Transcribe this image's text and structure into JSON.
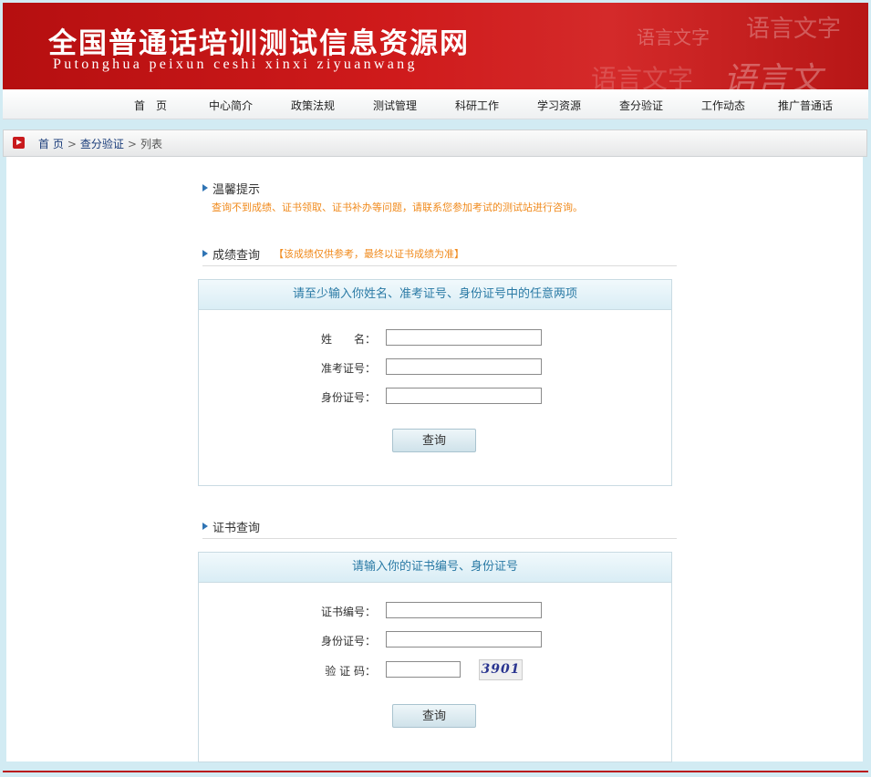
{
  "banner": {
    "title": "全国普通话培训测试信息资源网",
    "subtitle": "Putonghua peixun ceshi xinxi ziyuanwang",
    "decor_text": [
      "语言文字",
      "语言文字",
      "语言文字",
      "语言文"
    ]
  },
  "nav": {
    "items": [
      "首　页",
      "中心简介",
      "政策法规",
      "测试管理",
      "科研工作",
      "学习资源",
      "查分验证",
      "工作动态",
      "推广普通话"
    ]
  },
  "breadcrumb": {
    "home": "首 页",
    "section": "查分验证",
    "current": "列表",
    "separator": ">"
  },
  "tips": {
    "title": "温馨提示",
    "text": "查询不到成绩、证书领取、证书补办等问题，请联系您参加考试的测试站进行咨询。"
  },
  "score_query": {
    "title": "成绩查询",
    "note": "【该成绩仅供参考，最终以证书成绩为准】",
    "panel_title": "请至少输入你姓名、准考证号、身份证号中的任意两项",
    "fields": [
      {
        "label": "姓　　名：",
        "value": ""
      },
      {
        "label": "准考证号：",
        "value": ""
      },
      {
        "label": "身份证号：",
        "value": ""
      }
    ],
    "button": "查询"
  },
  "cert_query": {
    "title": "证书查询",
    "panel_title": "请输入你的证书编号、身份证号",
    "fields": [
      {
        "label": "证书编号：",
        "value": ""
      },
      {
        "label": "身份证号：",
        "value": ""
      },
      {
        "label": "验 证 码：",
        "value": ""
      }
    ],
    "captcha": "3901",
    "button": "查询"
  },
  "colors": {
    "banner_red": "#c8191c",
    "accent_orange": "#f08a1c",
    "panel_title_blue": "#2a7aa5",
    "page_bg": "#d2ebf3"
  }
}
